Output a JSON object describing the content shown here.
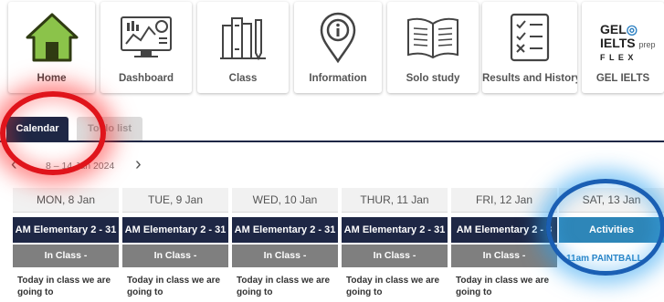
{
  "nav": {
    "items": [
      {
        "label": "Home",
        "icon": "home-icon"
      },
      {
        "label": "Dashboard",
        "icon": "dashboard-icon"
      },
      {
        "label": "Class",
        "icon": "class-icon"
      },
      {
        "label": "Information",
        "icon": "info-pin-icon"
      },
      {
        "label": "Solo study",
        "icon": "book-icon"
      },
      {
        "label": "Results and History",
        "icon": "checklist-icon"
      },
      {
        "label": "GEL IELTS",
        "icon": "gel-logo"
      }
    ],
    "logo": {
      "line1": "GEL",
      "line2": "IELTS",
      "line2_suffix": "prep",
      "line3": "F L E X"
    },
    "active_color": "#4a7a0f",
    "active_fill": "#8bc34a"
  },
  "tabs": {
    "calendar": "Calendar",
    "todo": "To do list"
  },
  "week": {
    "range": "8 – 14 Jan 2024"
  },
  "days": [
    {
      "head": "MON, 8 Jan",
      "cls": "AM Elementary 2 - 31",
      "status": "In Class -",
      "note": "Today in class we are going to"
    },
    {
      "head": "TUE, 9 Jan",
      "cls": "AM Elementary 2 - 31",
      "status": "In Class -",
      "note": "Today in class we are going to"
    },
    {
      "head": "WED, 10 Jan",
      "cls": "AM Elementary 2 - 31",
      "status": "In Class -",
      "note": "Today in class we are going to"
    },
    {
      "head": "THUR, 11 Jan",
      "cls": "AM Elementary 2 - 31",
      "status": "In Class -",
      "note": "Today in class we are going to"
    },
    {
      "head": "FRI, 12 Jan",
      "cls": "AM Elementary 2 - 3",
      "status": "In Class -",
      "note": "Today in class we are going to"
    },
    {
      "head": "SAT, 13 Jan",
      "cls": "Activities",
      "extra": "11am PAINTBALL"
    }
  ],
  "colors": {
    "navy": "#1e2745",
    "activity": "#2e86b8",
    "status_grey": "#7f7f7f"
  }
}
